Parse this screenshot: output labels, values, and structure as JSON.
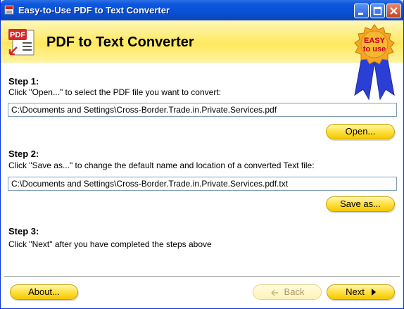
{
  "window": {
    "title": "Easy-to-Use PDF to Text Converter"
  },
  "header": {
    "title": "PDF to Text Converter",
    "logo_text": "PDF",
    "badge_line1": "EASY",
    "badge_line2": "to use"
  },
  "steps": [
    {
      "title": "Step 1:",
      "instruction": "Click \"Open...\" to select the PDF file you want to convert:",
      "field_value": "C:\\Documents and Settings\\Cross-Border.Trade.in.Private.Services.pdf",
      "button_label": "Open..."
    },
    {
      "title": "Step 2:",
      "instruction": "Click \"Save as...\" to change the default name and location of a converted Text file:",
      "field_value": "C:\\Documents and Settings\\Cross-Border.Trade.in.Private.Services.pdf.txt",
      "button_label": "Save as..."
    },
    {
      "title": "Step 3:",
      "instruction": "Click \"Next\" after you have completed the steps above"
    }
  ],
  "footer": {
    "about_label": "About...",
    "back_label": "Back",
    "next_label": "Next"
  },
  "icons": {
    "app": "pdf-app-icon",
    "logo": "pdf-document-icon",
    "badge": "award-ribbon-icon",
    "next": "arrow-right-icon",
    "back": "arrow-left-icon"
  },
  "colors": {
    "titlebar": "#0b58e0",
    "header_band": "#ffe860",
    "button_fill": "#ffe040",
    "badge": "#f5a623",
    "ribbon": "#2b3fd6"
  }
}
